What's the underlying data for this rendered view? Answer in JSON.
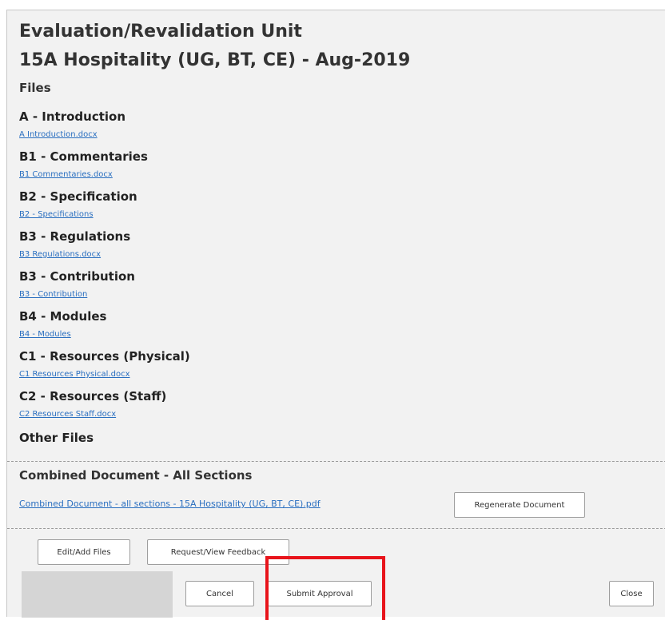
{
  "header": {
    "title": "Evaluation/Revalidation Unit",
    "subtitle": "15A Hospitality (UG, BT, CE) - Aug-2019"
  },
  "files_label": "Files",
  "sections": [
    {
      "heading": "A - Introduction",
      "link": "A Introduction.docx"
    },
    {
      "heading": "B1 - Commentaries",
      "link": "B1 Commentaries.docx"
    },
    {
      "heading": "B2 - Specification",
      "link": "B2 - Specifications"
    },
    {
      "heading": "B3 - Regulations",
      "link": "B3 Regulations.docx"
    },
    {
      "heading": "B3 - Contribution",
      "link": "B3 - Contribution"
    },
    {
      "heading": "B4 - Modules",
      "link": "B4 - Modules"
    },
    {
      "heading": "C1 - Resources (Physical)",
      "link": "C1 Resources Physical.docx"
    },
    {
      "heading": "C2 - Resources (Staff)",
      "link": "C2 Resources Staff.docx"
    }
  ],
  "other_files_label": "Other Files",
  "combined": {
    "title": "Combined Document - All Sections",
    "link": "Combined Document - all sections - 15A Hospitality (UG, BT, CE).pdf",
    "regenerate_label": "Regenerate Document"
  },
  "actions": {
    "edit_label": "Edit/Add Files",
    "feedback_label": "Request/View Feedback",
    "cancel_label": "Cancel",
    "submit_label": "Submit Approval",
    "close_label": "Close"
  },
  "colors": {
    "link": "#2a6fc0",
    "panel_bg": "#f2f2f2",
    "highlight": "#e8141b"
  }
}
